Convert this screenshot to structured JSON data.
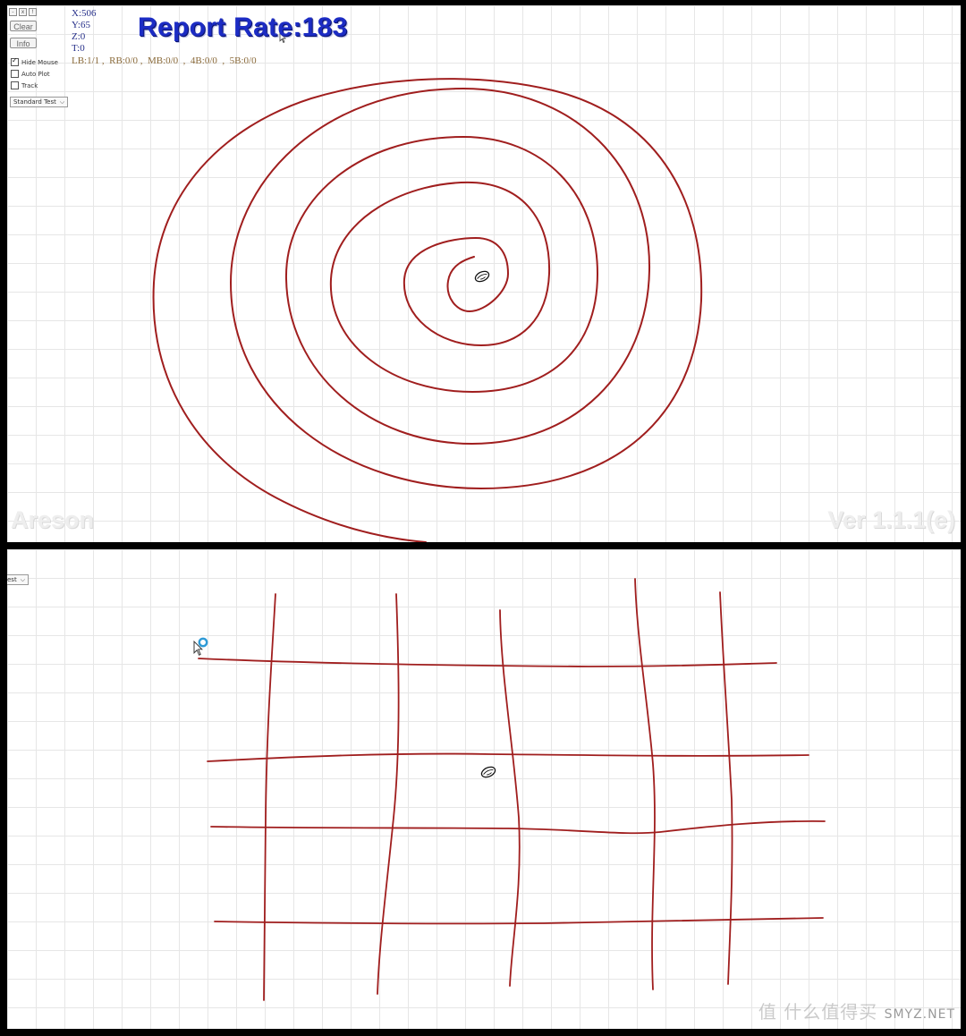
{
  "top_panel": {
    "window_buttons": [
      "-",
      "x",
      "!"
    ],
    "clear_label": "Clear",
    "info_label": "Info",
    "checkboxes": [
      {
        "label": "Hide Mouse",
        "checked": true
      },
      {
        "label": "Auto Plot",
        "checked": false
      },
      {
        "label": "Track",
        "checked": false
      }
    ],
    "mode_select": "Standard Test",
    "readout": {
      "x": "X:506",
      "y": "Y:65",
      "z": "Z:0",
      "t": "T:0"
    },
    "buttons_status": "LB:1/1 ,  RB:0/0 ,  MB:0/0  ,  4B:0/0  ,  5B:0/0",
    "report_rate": "Report Rate:183",
    "brand_watermark": "Areson",
    "version_watermark": "Ver 1.1.1(e)"
  },
  "bottom_panel": {
    "mode_select_partial": "est"
  },
  "site_watermark": {
    "cn": "值 什么值得买",
    "en": "SMYZ.NET"
  },
  "colors": {
    "trace": "#a01e1e",
    "report_rate": "#1c2cc4",
    "coord_text": "#27308a",
    "button_status_text": "#8a6a3a",
    "cursor_ring": "#2e9ad6"
  },
  "icons": {
    "mouse_marker": "mouse-outline-icon",
    "pointer": "arrow-cursor-icon",
    "click_marker": "blue-ring-icon"
  }
}
